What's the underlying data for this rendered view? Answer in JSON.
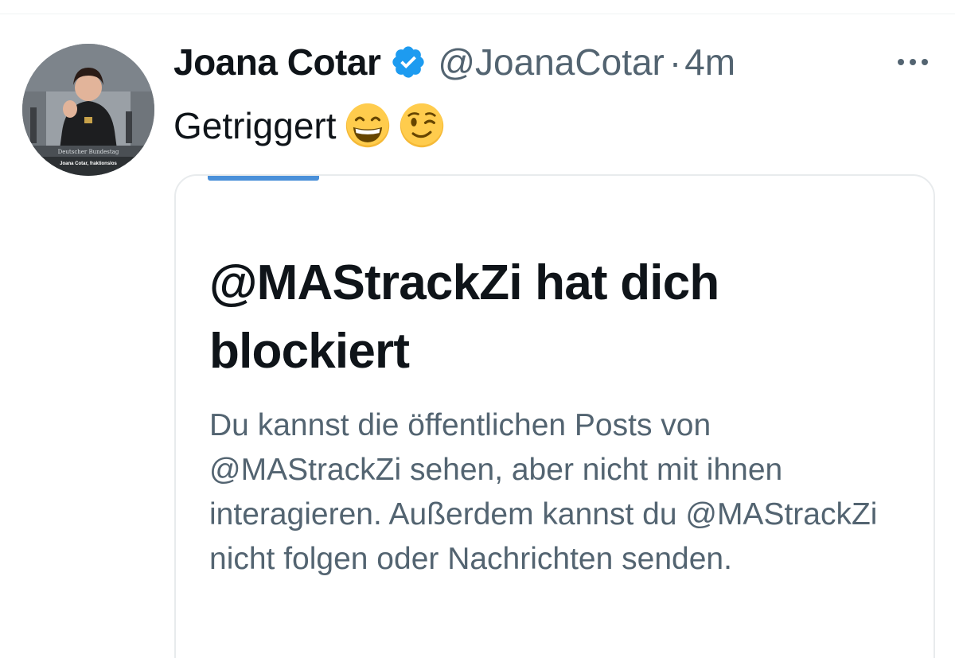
{
  "tweet": {
    "author_name": "Joana Cotar",
    "handle": "@JoanaCotar",
    "separator": "·",
    "time": "4m",
    "text": "Getriggert",
    "emojis": [
      "grinning-face-with-smiling-eyes",
      "winking-face"
    ],
    "verified_color": "#1d9bf0"
  },
  "avatar": {
    "caption_line1": "Deutscher Bundestag",
    "caption_line2": "Joana Cotar, fraktionslos"
  },
  "quoted_card": {
    "title": "@MAStrackZi hat dich blockiert",
    "body": "Du kannst die öffentlichen Posts von @MAStrackZi sehen, aber nicht mit ihnen interagieren. Außerdem kannst du @MAStrackZi nicht folgen oder Nachrichten senden.",
    "accent_color": "#4a90d9"
  },
  "icons": {
    "more": "more-horizontal-icon",
    "verified": "verified-badge-icon"
  }
}
